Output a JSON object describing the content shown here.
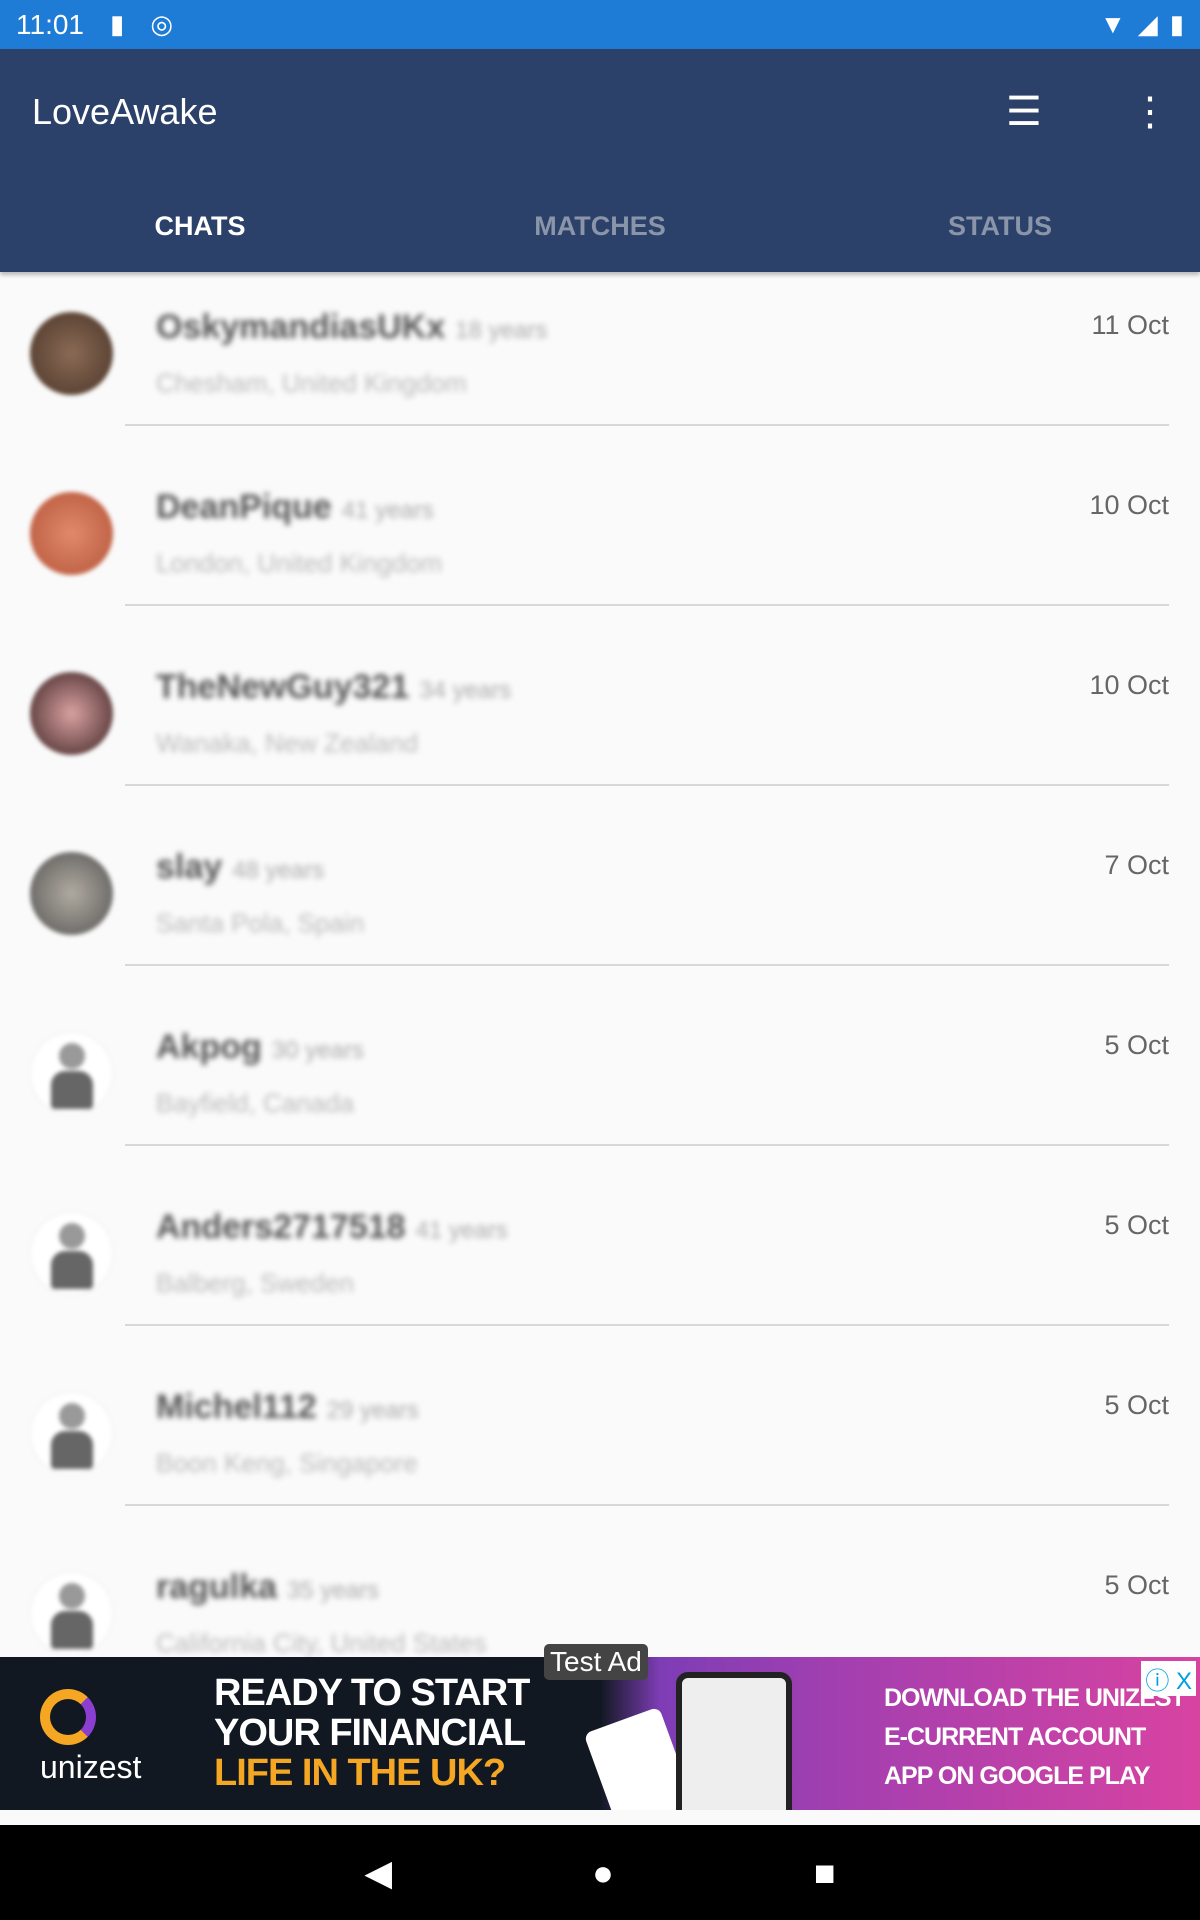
{
  "status_bar": {
    "time": "11:01",
    "icons": [
      "sd-card-icon",
      "data-saver-icon",
      "wifi-icon",
      "signal-icon",
      "battery-icon"
    ]
  },
  "colors": {
    "status_bar": "#1e7bd6",
    "toolbar": "#2c4169",
    "active_tab": "#ffffff",
    "inactive_tab": "#8a95a9"
  },
  "app": {
    "title": "LoveAwake",
    "icons": [
      "checklist-icon",
      "more-vert-icon"
    ]
  },
  "tabs": [
    {
      "label": "CHATS",
      "active": true
    },
    {
      "label": "MATCHES",
      "active": false
    },
    {
      "label": "STATUS",
      "active": false
    }
  ],
  "chats": [
    {
      "name": "OskymandiasUKx",
      "age": "18 years",
      "location": "Chesham, United Kingdom",
      "date": "11 Oct",
      "avatar": "photo"
    },
    {
      "name": "DeanPique",
      "age": "41 years",
      "location": "London, United Kingdom",
      "date": "10 Oct",
      "avatar": "photo"
    },
    {
      "name": "TheNewGuy321",
      "age": "34 years",
      "location": "Wanaka, New Zealand",
      "date": "10 Oct",
      "avatar": "photo"
    },
    {
      "name": "slay",
      "age": "48 years",
      "location": "Santa Pola, Spain",
      "date": "7 Oct",
      "avatar": "photo"
    },
    {
      "name": "Akpog",
      "age": "30 years",
      "location": "Bayfield, Canada",
      "date": "5 Oct",
      "avatar": "no-photo"
    },
    {
      "name": "Anders2717518",
      "age": "41 years",
      "location": "Balberg, Sweden",
      "date": "5 Oct",
      "avatar": "no-photo"
    },
    {
      "name": "Michel112",
      "age": "29 years",
      "location": "Boon Keng, Singapore",
      "date": "5 Oct",
      "avatar": "no-photo"
    },
    {
      "name": "ragulka",
      "age": "35 years",
      "location": "California City, United States",
      "date": "5 Oct",
      "avatar": "no-photo"
    }
  ],
  "ad": {
    "badge": "Test Ad",
    "brand": "unizest",
    "headline1": "READY TO START",
    "headline2": "YOUR FINANCIAL",
    "headline3": "LIFE IN THE UK?",
    "cta1": "DOWNLOAD THE UNIZEST",
    "cta2": "E-CURRENT ACCOUNT",
    "cta3": "APP ON GOOGLE PLAY",
    "close": "ⓘ X"
  }
}
